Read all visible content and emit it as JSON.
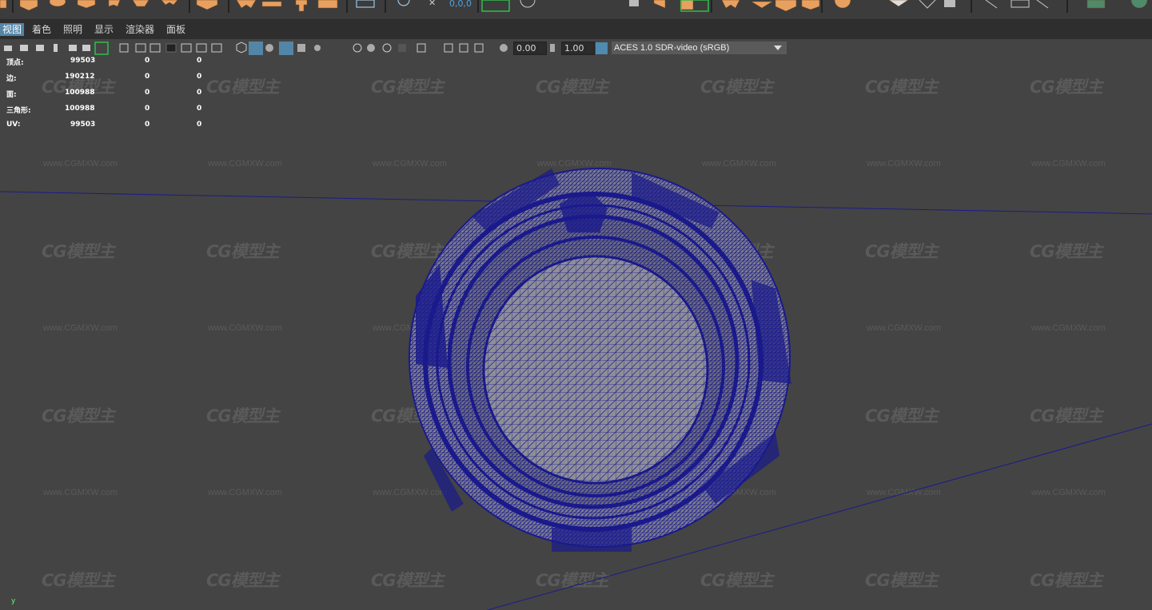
{
  "menu": {
    "items": [
      {
        "label": "视图"
      },
      {
        "label": "着色"
      },
      {
        "label": "照明"
      },
      {
        "label": "显示"
      },
      {
        "label": "渲染器"
      },
      {
        "label": "面板"
      }
    ]
  },
  "shelf": {
    "coord_readout": "0,0,0"
  },
  "panel_toolbar": {
    "exposure_value": "0.00",
    "gamma_value": "1.00",
    "color_space": "ACES 1.0 SDR-video (sRGB)"
  },
  "hud": {
    "rows": [
      {
        "label": "顶点:",
        "v1": "99503",
        "v2": "0",
        "v3": "0"
      },
      {
        "label": "边:",
        "v1": "190212",
        "v2": "0",
        "v3": "0"
      },
      {
        "label": "面:",
        "v1": "100988",
        "v2": "0",
        "v3": "0"
      },
      {
        "label": "三角形:",
        "v1": "100988",
        "v2": "0",
        "v3": "0"
      },
      {
        "label": "UV:",
        "v1": "99503",
        "v2": "0",
        "v3": "0"
      }
    ]
  },
  "watermark": {
    "logo_text": "CG模型主",
    "url_text": "www.CGMXW.com"
  },
  "axis": {
    "y_label": "y"
  },
  "colors": {
    "wireframe": "#1a1a8c",
    "viewport_bg": "#444444",
    "menu_highlight": "#5285a6",
    "shelf_orange": "#e8a060"
  }
}
